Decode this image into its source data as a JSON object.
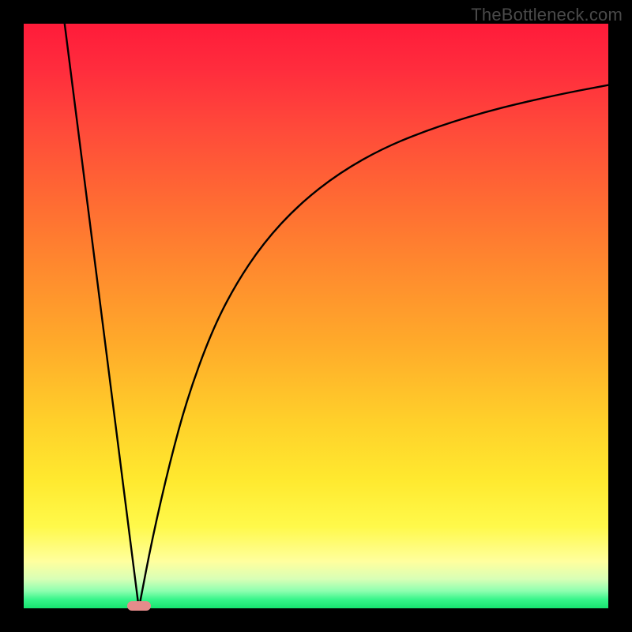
{
  "watermark": {
    "text": "TheBottleneck.com"
  },
  "chart_data": {
    "type": "line",
    "title": "",
    "xlabel": "",
    "ylabel": "",
    "xlim": [
      0,
      100
    ],
    "ylim": [
      0,
      100
    ],
    "grid": false,
    "legend": false,
    "series": [
      {
        "name": "left-slope",
        "x": [
          7,
          19.7
        ],
        "values": [
          100,
          0
        ]
      },
      {
        "name": "right-curve",
        "x": [
          19.7,
          22,
          25,
          28,
          32,
          36,
          41,
          47,
          54,
          62,
          71,
          81,
          92,
          100
        ],
        "values": [
          0,
          12,
          25,
          36,
          47,
          55,
          62.5,
          69,
          74.5,
          79,
          82.5,
          85.5,
          88,
          89.5
        ]
      }
    ],
    "marker": {
      "name": "bottleneck-marker",
      "x_center": 19.7,
      "y": 0,
      "width_pct": 4.0,
      "color": "#e58b8b"
    },
    "background_gradient": {
      "top": "#ff1b3a",
      "upper_mid": "#ff8a2e",
      "mid": "#ffe92f",
      "lower": "#17e36f"
    }
  }
}
